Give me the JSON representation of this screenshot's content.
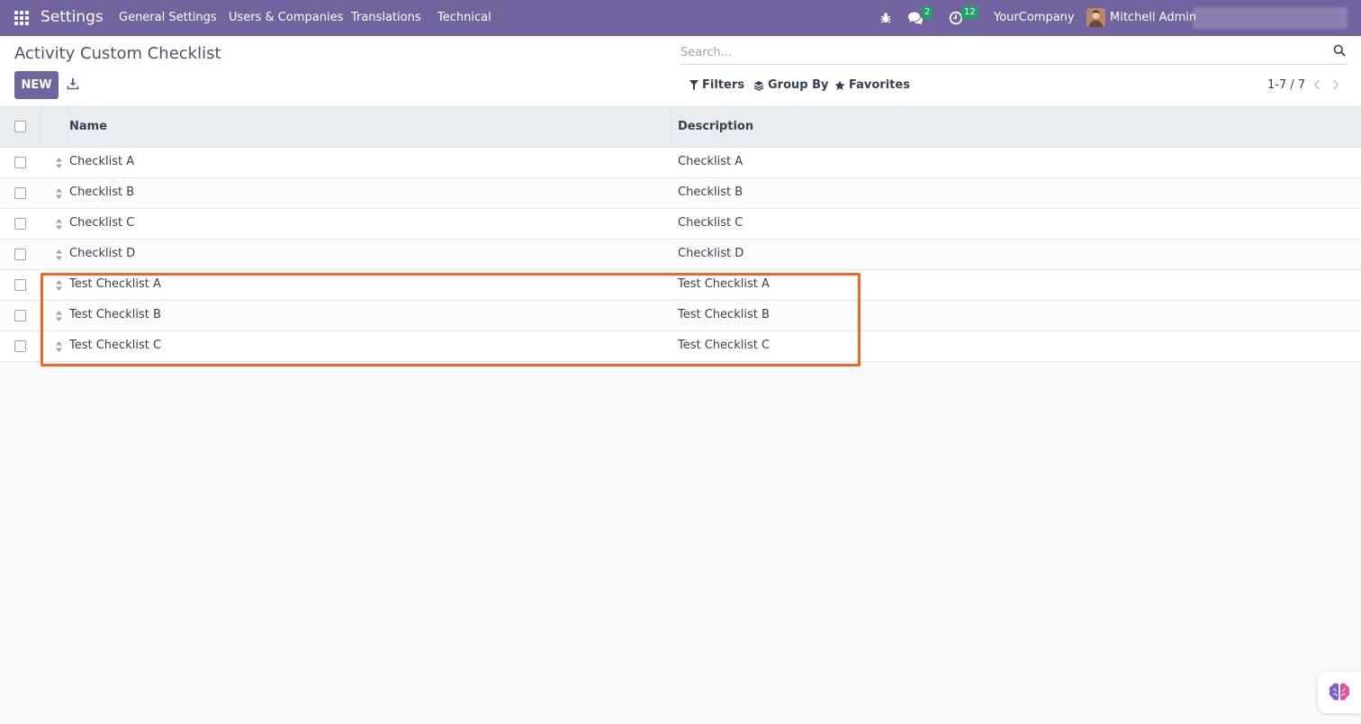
{
  "navbar": {
    "app_name": "Settings",
    "menu": [
      "General Settings",
      "Users & Companies",
      "Translations",
      "Technical"
    ],
    "messages_badge": "2",
    "activities_badge": "12",
    "company": "YourCompany",
    "user": "Mitchell Admin"
  },
  "control_panel": {
    "title": "Activity Custom Checklist",
    "new_label": "NEW",
    "search_placeholder": "Search...",
    "filters_label": "Filters",
    "group_by_label": "Group By",
    "favorites_label": "Favorites",
    "pager": "1-7 / 7"
  },
  "table": {
    "columns": [
      "Name",
      "Description"
    ],
    "rows": [
      {
        "name": "Checklist A",
        "description": "Checklist A"
      },
      {
        "name": "Checklist B",
        "description": "Checklist B"
      },
      {
        "name": "Checklist C",
        "description": "Checklist C"
      },
      {
        "name": "Checklist D",
        "description": "Checklist D"
      },
      {
        "name": "Test Checklist A",
        "description": "Test Checklist A"
      },
      {
        "name": "Test Checklist B",
        "description": "Test Checklist B"
      },
      {
        "name": "Test Checklist C",
        "description": "Test Checklist C"
      }
    ]
  },
  "colors": {
    "brand": "#71639e",
    "highlight": "#f26522",
    "badge": "#1fa069"
  },
  "icons": [
    "apps-grid-icon",
    "bug-icon",
    "chat-icon",
    "clock-icon",
    "download-icon",
    "search-icon",
    "filter-icon",
    "layers-icon",
    "star-icon",
    "chevron-left-icon",
    "chevron-right-icon",
    "drag-handle-icon",
    "brain-assistant-icon"
  ]
}
